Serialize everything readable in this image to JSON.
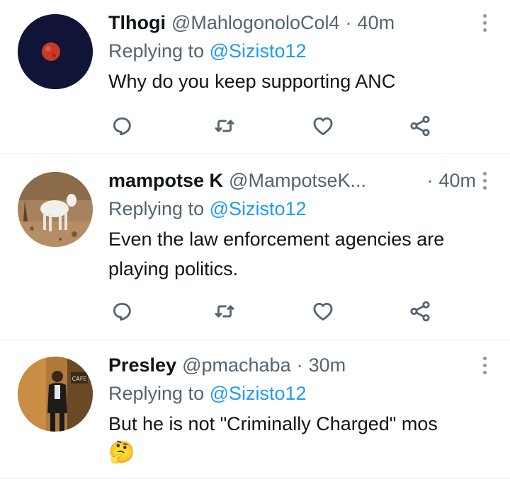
{
  "colors": {
    "text_primary": "#0f1419",
    "text_secondary": "#536471",
    "link": "#1d9bf0",
    "icon": "#536471",
    "divider": "#e6ecf0"
  },
  "tweets": [
    {
      "display_name": "Tlhogi",
      "handle": "@MahlogonoloCol4",
      "separator": "·",
      "time": "40m",
      "replying_prefix": "Replying to ",
      "replying_to": "@Sizisto12",
      "text": "Why do you keep supporting ANC",
      "avatar": "blood-moon-avatar"
    },
    {
      "display_name": "mampotse K",
      "handle": "@MampotseK...",
      "separator": "·",
      "time": "40m",
      "replying_prefix": "Replying to ",
      "replying_to": "@Sizisto12",
      "text": "Even the law enforcement agencies are playing politics.",
      "avatar": "goat-avatar"
    },
    {
      "display_name": "Presley",
      "handle": "@pmachaba",
      "separator": "·",
      "time": "30m",
      "replying_prefix": "Replying to ",
      "replying_to": "@Sizisto12",
      "text": "But he is not \"Criminally Charged\" mos",
      "emoji": "🤔",
      "avatar_text": "CAFE",
      "avatar": "man-in-suit-avatar"
    }
  ],
  "actions": {
    "reply_icon": "reply-icon",
    "retweet_icon": "retweet-icon",
    "like_icon": "heart-icon",
    "share_icon": "share-icon"
  }
}
